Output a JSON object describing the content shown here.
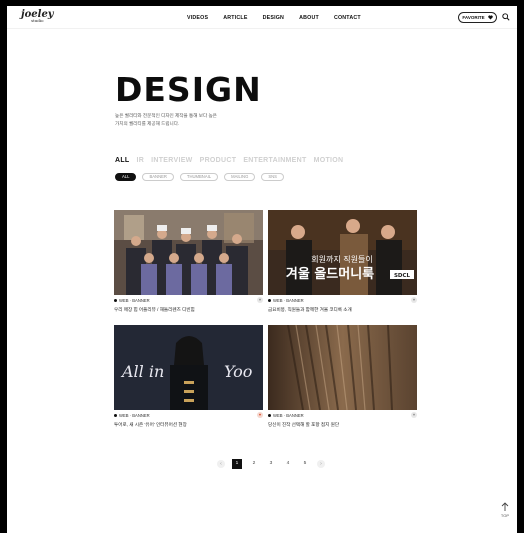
{
  "header": {
    "logo": "joeley",
    "logo_sub": "studio",
    "nav": [
      "VIDEOS",
      "ARTICLE",
      "DESIGN",
      "ABOUT",
      "CONTACT"
    ],
    "favorite_label": "FAVORITE",
    "favorite_icon": "heart-icon",
    "search_icon": "search-icon"
  },
  "hero": {
    "title": "DESIGN",
    "description_1": "높은 퀄리티와 전문적인 디자인 제작을 통해 보다 높은",
    "description_2": "가치의 퀄리티를 제공해 드립니다."
  },
  "categories": [
    "ALL",
    "IR",
    "INTERVIEW",
    "PRODUCT",
    "ENTERTAINMENT",
    "MOTION"
  ],
  "active_category": "ALL",
  "filters": [
    "ALL",
    "BANNER",
    "THUMBNAIL",
    "MAILING",
    "SNS"
  ],
  "active_filter": "ALL",
  "cards": [
    {
      "meta": "WEB · BANNER",
      "title": "우리 매장 힙 어플리뷰 / 해돌리렌즈 디빈힘",
      "liked": false
    },
    {
      "meta": "WEB · BANNER",
      "title": "금요비몽, 직원들과 함께한 겨울 코디룩 소개",
      "liked": false,
      "overlay_1": "회원까지 직원들이",
      "overlay_2": "겨울 올드머니룩",
      "overlay_badge": "SDCL"
    },
    {
      "meta": "WEB · BANNER",
      "title": "투어로, 새 시즌 '유어' 인터뷰어션 현장",
      "liked": true,
      "overlay_1": "All in",
      "overlay_2": "Yoo"
    },
    {
      "meta": "WEB · BANNER",
      "title": "당신이 진작 선택해 할 포항 접지 원단",
      "liked": false
    }
  ],
  "pagination": {
    "pages": [
      "1",
      "2",
      "3",
      "4",
      "5"
    ],
    "current": "1",
    "prev": "‹",
    "next": "›"
  },
  "top_label": "TOP"
}
